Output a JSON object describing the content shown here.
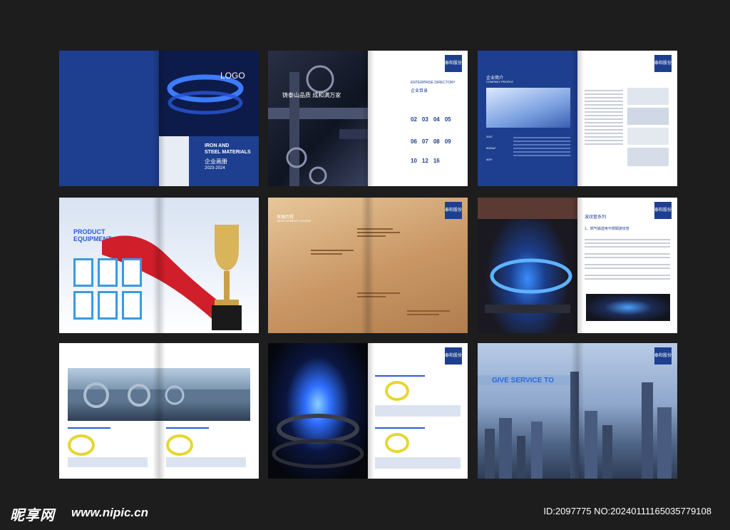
{
  "spreads": {
    "s1": {
      "logo": "LOGO",
      "title_en_1": "IRON AND",
      "title_en_2": "STEEL MATERIALS",
      "title_cn": "企业画册",
      "years": "2023-2024"
    },
    "s2": {
      "slogan": "铸泰山品质 成和满万家",
      "dir_en": "ENTERPRISE DIRECTORY",
      "dir_cn": "企业目录",
      "nums": [
        "02",
        "03",
        "04",
        "05",
        "06",
        "07",
        "08",
        "09",
        "10",
        "12",
        "16"
      ],
      "badge": "泰和股份"
    },
    "s3": {
      "title_cn": "企业简介",
      "title_en": "COMPANY PROFILE",
      "stats": [
        "2007",
        "5000m²",
        "400+"
      ],
      "badge": "泰和股份"
    },
    "s4": {
      "title_1": "PRODUCT",
      "title_2": "EQUIPMENT"
    },
    "s5": {
      "title_cn": "发展历程",
      "title_en": "DEVELOPMENT COURSE",
      "badge": "泰和股份"
    },
    "s6": {
      "title_cn": "波纹管系列",
      "subtitle": "1、燃气输送用不锈钢波纹管",
      "badge": "泰和股份"
    },
    "s8": {
      "badge": "泰和股份"
    },
    "s9": {
      "title": "GIVE SERVICE TO",
      "badge": "泰和股份"
    }
  },
  "watermark": {
    "logo": "昵享网",
    "url": "www.nipic.cn",
    "id": "ID:2097775 NO:20240111165035779108"
  },
  "colors": {
    "navy": "#1e3f8f",
    "accent_blue": "#2a5bd8",
    "background": "#1d1d1d"
  }
}
